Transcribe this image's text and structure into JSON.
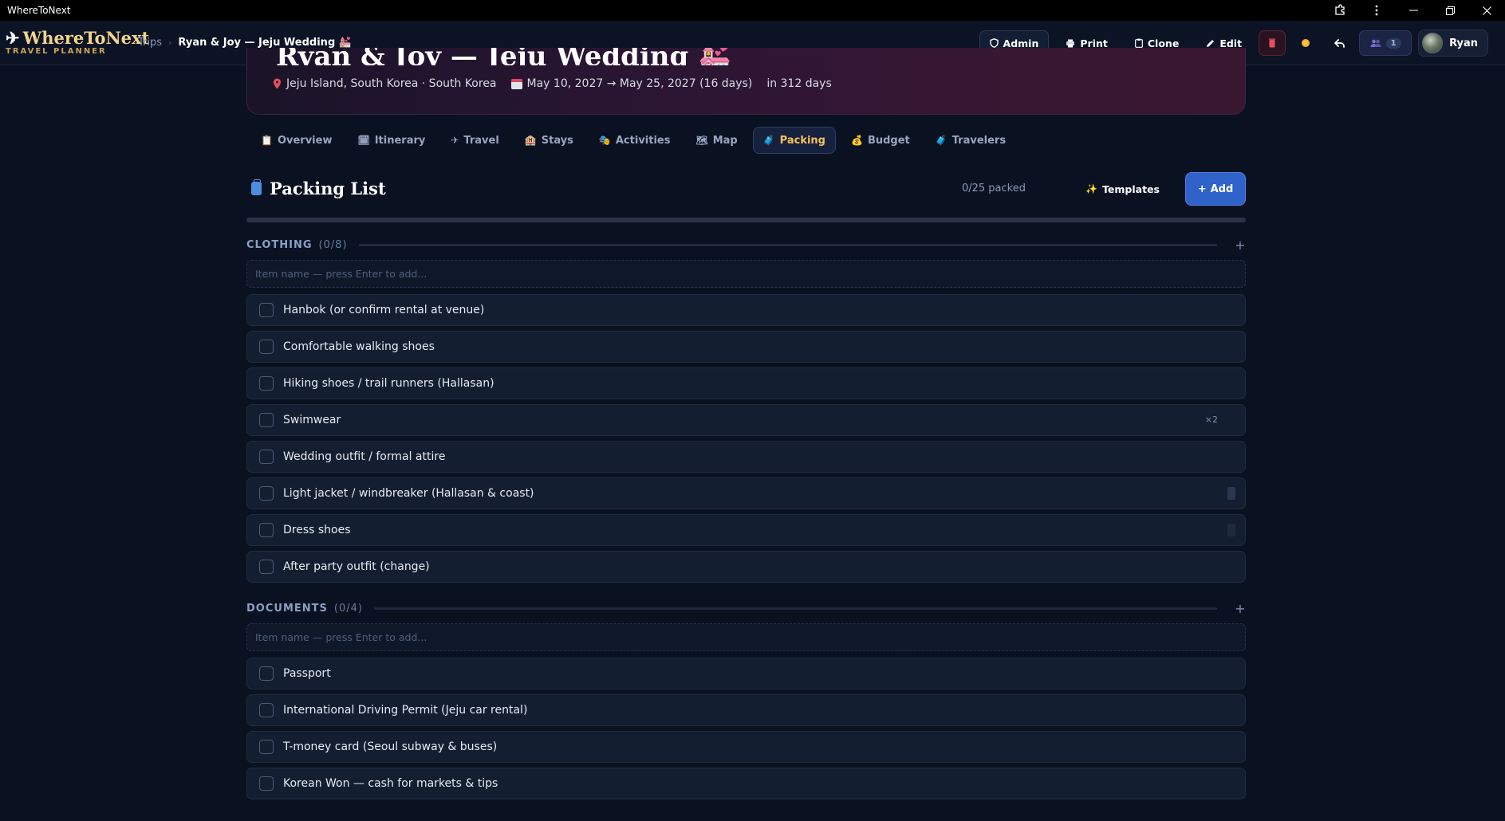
{
  "window": {
    "title": "WhereToNext"
  },
  "brand": {
    "name": "WhereToNext",
    "subtitle": "TRAVEL PLANNER"
  },
  "breadcrumb": {
    "trips": "Trips",
    "current": "Ryan & Joy — Jeju Wedding 💒"
  },
  "actions": {
    "admin": "Admin",
    "print": "Print",
    "clone": "Clone",
    "edit": "Edit",
    "people_count": "1",
    "user_name": "Ryan"
  },
  "trip": {
    "location": "Jeju Island, South Korea · South Korea",
    "dates": "May 10, 2027 → May 25, 2027 (16 days)",
    "countdown": "in 312 days"
  },
  "tabs": [
    {
      "label": "Overview",
      "icon": "📋"
    },
    {
      "label": "Itinerary",
      "icon": "🗓"
    },
    {
      "label": "Travel",
      "icon": "✈"
    },
    {
      "label": "Stays",
      "icon": "🏨"
    },
    {
      "label": "Activities",
      "icon": "🎭"
    },
    {
      "label": "Map",
      "icon": "🗺"
    },
    {
      "label": "Packing",
      "icon": "🧳"
    },
    {
      "label": "Budget",
      "icon": "💰"
    },
    {
      "label": "Travelers",
      "icon": "🧳"
    }
  ],
  "packing": {
    "title": "Packing List",
    "count": "0/25 packed",
    "templates_label": "Templates",
    "add_label": "Add",
    "progress": 0,
    "categories": [
      {
        "name": "CLOTHING",
        "count": "(0/8)",
        "placeholder": "Item name — press Enter to add...",
        "items": [
          {
            "label": "Hanbok (or confirm rental at venue)"
          },
          {
            "label": "Comfortable walking shoes"
          },
          {
            "label": "Hiking shoes / trail runners (Hallasan)"
          },
          {
            "label": "Swimwear",
            "qty": "×2"
          },
          {
            "label": "Wedding outfit / formal attire"
          },
          {
            "label": "Light jacket / windbreaker (Hallasan & coast)"
          },
          {
            "label": "Dress shoes"
          },
          {
            "label": "After party outfit (change)"
          }
        ]
      },
      {
        "name": "DOCUMENTS",
        "count": "(0/4)",
        "placeholder": "Item name — press Enter to add...",
        "items": [
          {
            "label": "Passport"
          },
          {
            "label": "International Driving Permit (Jeju car rental)"
          },
          {
            "label": "T-money card (Seoul subway & buses)"
          },
          {
            "label": "Korean Won — cash for markets & tips"
          }
        ]
      }
    ]
  },
  "colors": {
    "accent": "#2f63c9",
    "active_tab": "#f5c25a",
    "brand": "#f3d48a"
  }
}
